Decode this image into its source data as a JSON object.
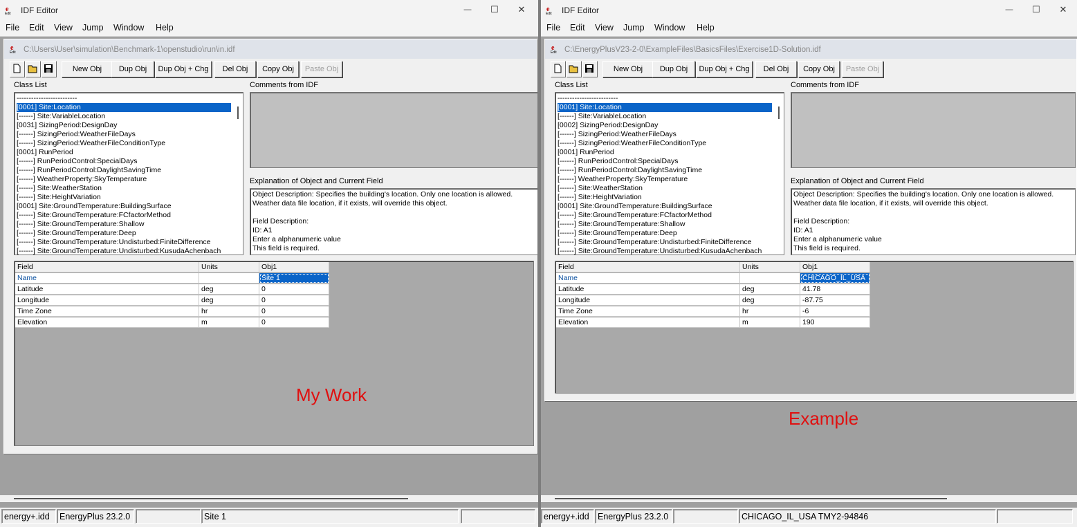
{
  "left": {
    "app_title": "IDF Editor",
    "menu": [
      "File",
      "Edit",
      "View",
      "Jump",
      "Window",
      "Help"
    ],
    "doc_path": "C:\\Users\\User\\simulation\\Benchmark-1\\openstudio\\run\\in.idf",
    "toolbar": {
      "new_obj": "New Obj",
      "dup_obj": "Dup Obj",
      "dup_obj_chg": "Dup Obj + Chg",
      "del_obj": "Del Obj",
      "copy_obj": "Copy Obj",
      "paste_obj": "Paste Obj"
    },
    "class_list_label": "Class List",
    "comments_label": "Comments from IDF",
    "explanation_label": "Explanation of Object and Current Field",
    "class_list": [
      "-------------------------",
      "[0001]  Site:Location",
      "[------]  Site:VariableLocation",
      "[0031]  SizingPeriod:DesignDay",
      "[------]  SizingPeriod:WeatherFileDays",
      "[------]  SizingPeriod:WeatherFileConditionType",
      "[0001]  RunPeriod",
      "[------]  RunPeriodControl:SpecialDays",
      "[------]  RunPeriodControl:DaylightSavingTime",
      "[------]  WeatherProperty:SkyTemperature",
      "[------]  Site:WeatherStation",
      "[------]  Site:HeightVariation",
      "[0001]  Site:GroundTemperature:BuildingSurface",
      "[------]  Site:GroundTemperature:FCfactorMethod",
      "[------]  Site:GroundTemperature:Shallow",
      "[------]  Site:GroundTemperature:Deep",
      "[------]  Site:GroundTemperature:Undisturbed:FiniteDifference",
      "[------]  Site:GroundTemperature:Undisturbed:KusudaAchenbach"
    ],
    "explanation": [
      "Object Description: Specifies the building's location. Only one location is allowed.",
      "Weather data file location, if it exists, will override this object.",
      "",
      "Field Description:",
      "ID: A1",
      "Enter a alphanumeric value",
      "This field is required."
    ],
    "grid_headers": [
      "Field",
      "Units",
      "Obj1"
    ],
    "grid_rows": [
      {
        "field": "Name",
        "units": "",
        "value": "Site 1"
      },
      {
        "field": "Latitude",
        "units": "deg",
        "value": "0"
      },
      {
        "field": "Longitude",
        "units": "deg",
        "value": "0"
      },
      {
        "field": "Time Zone",
        "units": "hr",
        "value": "0"
      },
      {
        "field": "Elevation",
        "units": "m",
        "value": "0"
      }
    ],
    "overlay_text": "My Work",
    "status": [
      "energy+.idd",
      "EnergyPlus 23.2.0",
      "",
      "Site 1",
      ""
    ]
  },
  "right": {
    "app_title": "IDF Editor",
    "menu": [
      "File",
      "Edit",
      "View",
      "Jump",
      "Window",
      "Help"
    ],
    "doc_path": "C:\\EnergyPlusV23-2-0\\ExampleFiles\\BasicsFiles\\Exercise1D-Solution.idf",
    "toolbar": {
      "new_obj": "New Obj",
      "dup_obj": "Dup Obj",
      "dup_obj_chg": "Dup Obj + Chg",
      "del_obj": "Del Obj",
      "copy_obj": "Copy Obj",
      "paste_obj": "Paste Obj"
    },
    "class_list_label": "Class List",
    "comments_label": "Comments from IDF",
    "explanation_label": "Explanation of Object and Current Field",
    "class_list": [
      "-------------------------",
      "[0001]  Site:Location",
      "[------]  Site:VariableLocation",
      "[0002]  SizingPeriod:DesignDay",
      "[------]  SizingPeriod:WeatherFileDays",
      "[------]  SizingPeriod:WeatherFileConditionType",
      "[0001]  RunPeriod",
      "[------]  RunPeriodControl:SpecialDays",
      "[------]  RunPeriodControl:DaylightSavingTime",
      "[------]  WeatherProperty:SkyTemperature",
      "[------]  Site:WeatherStation",
      "[------]  Site:HeightVariation",
      "[0001]  Site:GroundTemperature:BuildingSurface",
      "[------]  Site:GroundTemperature:FCfactorMethod",
      "[------]  Site:GroundTemperature:Shallow",
      "[------]  Site:GroundTemperature:Deep",
      "[------]  Site:GroundTemperature:Undisturbed:FiniteDifference",
      "[------]  Site:GroundTemperature:Undisturbed:KusudaAchenbach"
    ],
    "explanation": [
      "Object Description: Specifies the building's location. Only one location is allowed.",
      "Weather data file location, if it exists, will override this object.",
      "",
      "Field Description:",
      "ID: A1",
      "Enter a alphanumeric value",
      "This field is required."
    ],
    "grid_headers": [
      "Field",
      "Units",
      "Obj1"
    ],
    "grid_rows": [
      {
        "field": "Name",
        "units": "",
        "value": "CHICAGO_IL_USA"
      },
      {
        "field": "Latitude",
        "units": "deg",
        "value": "41.78"
      },
      {
        "field": "Longitude",
        "units": "deg",
        "value": "-87.75"
      },
      {
        "field": "Time Zone",
        "units": "hr",
        "value": "-6"
      },
      {
        "field": "Elevation",
        "units": "m",
        "value": "190"
      }
    ],
    "overlay_text": "Example",
    "status": [
      "energy+.idd",
      "EnergyPlus 23.2.0",
      "",
      "CHICAGO_IL_USA TMY2-94846",
      ""
    ]
  },
  "icons": {
    "app": "idf-edit-app-icon",
    "new": "new-file-icon",
    "open": "open-folder-icon",
    "save": "save-disk-icon",
    "minimize": "minimize-icon",
    "maximize": "maximize-icon",
    "close": "close-icon"
  },
  "colors": {
    "selection": "#0a64c8",
    "overlay": "#e01010",
    "name_field": "#0a50a0"
  }
}
